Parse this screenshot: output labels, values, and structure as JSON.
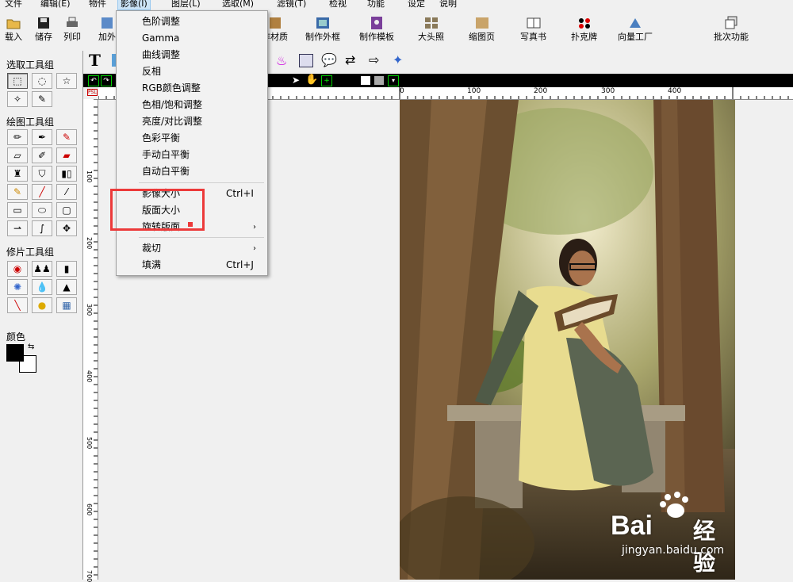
{
  "menubar": {
    "items": [
      "文件",
      "编辑(E)",
      "物件",
      "影像(I)",
      "图层(L)",
      "选取(M)",
      "滤镜(T)",
      "检视",
      "功能",
      "设定",
      "说明"
    ]
  },
  "toolbar": {
    "buttons": [
      "载入",
      "储存",
      "列印",
      "加外",
      "作材质",
      "制作外框",
      "制作模板",
      "大头照",
      "缩图页",
      "写真书",
      "扑克牌",
      "向量工厂",
      "批次功能"
    ]
  },
  "left_panel": {
    "select_group": "选取工具组",
    "draw_group": "绘图工具组",
    "retouch_group": "修片工具组",
    "color_label": "颜色"
  },
  "dropdown": {
    "items": [
      {
        "label": "色阶调整",
        "shortcut": "",
        "submenu": false
      },
      {
        "label": "Gamma",
        "shortcut": "",
        "submenu": false
      },
      {
        "label": "曲线调整",
        "shortcut": "",
        "submenu": false
      },
      {
        "label": "反相",
        "shortcut": "",
        "submenu": false
      },
      {
        "label": "RGB颜色调整",
        "shortcut": "",
        "submenu": false
      },
      {
        "label": "色相/饱和调整",
        "shortcut": "",
        "submenu": false
      },
      {
        "label": "亮度/对比调整",
        "shortcut": "",
        "submenu": false
      },
      {
        "label": "色彩平衡",
        "shortcut": "",
        "submenu": false
      },
      {
        "label": "手动白平衡",
        "shortcut": "",
        "submenu": false
      },
      {
        "label": "自动白平衡",
        "shortcut": "",
        "submenu": false
      },
      {
        "label": "影像大小",
        "shortcut": "Ctrl+I",
        "submenu": false
      },
      {
        "label": "版面大小",
        "shortcut": "",
        "submenu": false
      },
      {
        "label": "旋转版面",
        "shortcut": "",
        "submenu": true
      },
      {
        "label": "裁切",
        "shortcut": "",
        "submenu": true
      },
      {
        "label": "填满",
        "shortcut": "Ctrl+J",
        "submenu": false
      }
    ]
  },
  "ruler": {
    "h_ticks": [
      "0",
      "100",
      "200",
      "300",
      "400"
    ],
    "v_ticks": [
      "100",
      "200",
      "300",
      "400",
      "500",
      "600",
      "700"
    ]
  },
  "watermark": {
    "brand": "Bai",
    "brand_cn": "经验",
    "url": "jingyan.baidu.com"
  },
  "colors": {
    "foreground": "#000000",
    "background": "#ffffff",
    "highlight": "#ec3a3a"
  }
}
